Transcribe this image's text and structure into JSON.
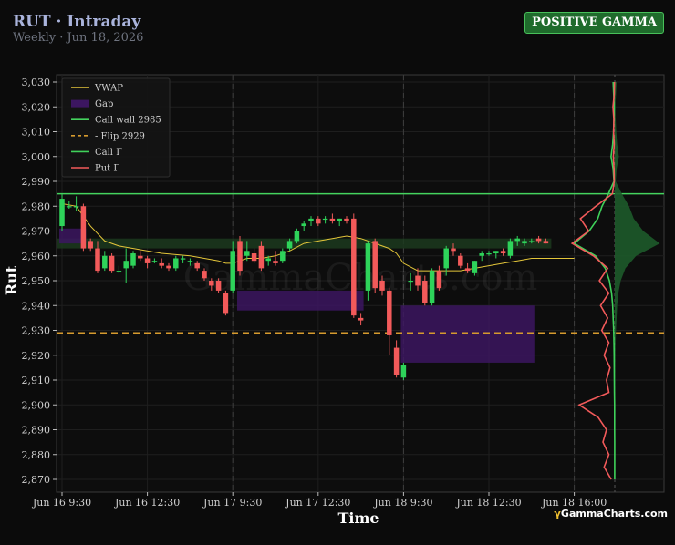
{
  "header": {
    "title": "RUT · Intraday",
    "subtitle": "Weekly · Jun 18, 2026",
    "badge": "POSITIVE GAMMA"
  },
  "watermark": "GammaCharts.com",
  "logo": {
    "glyph": "γ",
    "text": "GammaCharts.com"
  },
  "colors": {
    "background": "#0b0b0b",
    "up": "#2ed35a",
    "down": "#f25a5a",
    "vwap": "#e3c53a",
    "gap": "#3c1660",
    "call_wall": "#44d35e",
    "flip": "#d69a2e",
    "call_gamma": "#3fd15a",
    "put_gamma": "#f25a5a",
    "positive_zone": "#1c3a1f"
  },
  "chart_data": {
    "type": "candlestick",
    "xlabel": "Time",
    "ylabel": "Rut",
    "ylim": [
      2866,
      3032
    ],
    "xlim": [
      0,
      68
    ],
    "y_ticks": [
      2870,
      2880,
      2890,
      2900,
      2910,
      2920,
      2930,
      2940,
      2950,
      2960,
      2970,
      2980,
      2990,
      3000,
      3010,
      3020,
      3030
    ],
    "x_ticks": [
      {
        "x": 0,
        "label": "Jun 16 9:30"
      },
      {
        "x": 12,
        "label": "Jun 16 12:30"
      },
      {
        "x": 24,
        "label": "Jun 17 9:30"
      },
      {
        "x": 36,
        "label": "Jun 17 12:30"
      },
      {
        "x": 48,
        "label": "Jun 18 9:30"
      },
      {
        "x": 60,
        "label": "Jun 18 12:30"
      },
      {
        "x": 72,
        "label": "Jun 18 16:00"
      }
    ],
    "session_breaks": [
      24,
      48,
      72
    ],
    "grid": true,
    "legend_position": "top-left",
    "legend": [
      {
        "kind": "line",
        "label": "VWAP",
        "color": "#e3c53a"
      },
      {
        "kind": "box",
        "label": "Gap",
        "color": "#3c1660"
      },
      {
        "kind": "line",
        "label": "Call wall 2985",
        "color": "#44d35e"
      },
      {
        "kind": "dash",
        "label": "- Flip 2929",
        "color": "#d69a2e"
      },
      {
        "kind": "line",
        "label": "Call Γ",
        "color": "#3fd15a"
      },
      {
        "kind": "line",
        "label": "Put Γ",
        "color": "#f25a5a"
      }
    ],
    "levels": {
      "call_wall": 2985,
      "flip": 2929,
      "positive_zone": [
        2963,
        2967
      ]
    },
    "gaps": [
      {
        "x0": 0,
        "x1": 3,
        "y0": 2965,
        "y1": 2971
      },
      {
        "x0": 25,
        "x1": 42,
        "y0": 2938,
        "y1": 2946
      },
      {
        "x0": 48,
        "x1": 66,
        "y0": 2917,
        "y1": 2940
      }
    ],
    "candles": [
      {
        "x": 0,
        "o": 2972,
        "h": 2985,
        "l": 2970,
        "c": 2983
      },
      {
        "x": 1,
        "o": 2980,
        "h": 2982,
        "l": 2979,
        "c": 2980
      },
      {
        "x": 2,
        "o": 2980,
        "h": 2984,
        "l": 2978,
        "c": 2980
      },
      {
        "x": 3,
        "o": 2980,
        "h": 2981,
        "l": 2962,
        "c": 2963
      },
      {
        "x": 4,
        "o": 2966,
        "h": 2967,
        "l": 2962,
        "c": 2963
      },
      {
        "x": 5,
        "o": 2963,
        "h": 2966,
        "l": 2953,
        "c": 2954
      },
      {
        "x": 6,
        "o": 2955,
        "h": 2962,
        "l": 2954,
        "c": 2960
      },
      {
        "x": 7,
        "o": 2960,
        "h": 2961,
        "l": 2953,
        "c": 2954
      },
      {
        "x": 8,
        "o": 2954,
        "h": 2956,
        "l": 2953,
        "c": 2954
      },
      {
        "x": 9,
        "o": 2955,
        "h": 2963,
        "l": 2949,
        "c": 2958
      },
      {
        "x": 10,
        "o": 2956,
        "h": 2962,
        "l": 2955,
        "c": 2961
      },
      {
        "x": 11,
        "o": 2960,
        "h": 2962,
        "l": 2958,
        "c": 2959
      },
      {
        "x": 12,
        "o": 2959,
        "h": 2960,
        "l": 2955,
        "c": 2957
      },
      {
        "x": 13,
        "o": 2958,
        "h": 2959,
        "l": 2957,
        "c": 2958
      },
      {
        "x": 14,
        "o": 2957,
        "h": 2959,
        "l": 2955,
        "c": 2956
      },
      {
        "x": 15,
        "o": 2956,
        "h": 2957,
        "l": 2954,
        "c": 2955
      },
      {
        "x": 16,
        "o": 2955,
        "h": 2960,
        "l": 2954,
        "c": 2959
      },
      {
        "x": 17,
        "o": 2959,
        "h": 2960,
        "l": 2957,
        "c": 2959
      },
      {
        "x": 18,
        "o": 2958,
        "h": 2959,
        "l": 2956,
        "c": 2958
      },
      {
        "x": 19,
        "o": 2957,
        "h": 2958,
        "l": 2954,
        "c": 2955
      },
      {
        "x": 20,
        "o": 2954,
        "h": 2955,
        "l": 2950,
        "c": 2951
      },
      {
        "x": 21,
        "o": 2950,
        "h": 2951,
        "l": 2946,
        "c": 2948
      },
      {
        "x": 22,
        "o": 2950,
        "h": 2951,
        "l": 2945,
        "c": 2946
      },
      {
        "x": 23,
        "o": 2945,
        "h": 2946,
        "l": 2936,
        "c": 2937
      },
      {
        "x": 24,
        "o": 2946,
        "h": 2966,
        "l": 2945,
        "c": 2962
      },
      {
        "x": 25,
        "o": 2966,
        "h": 2968,
        "l": 2952,
        "c": 2954
      },
      {
        "x": 26,
        "o": 2960,
        "h": 2966,
        "l": 2958,
        "c": 2962
      },
      {
        "x": 27,
        "o": 2961,
        "h": 2963,
        "l": 2957,
        "c": 2958
      },
      {
        "x": 28,
        "o": 2964,
        "h": 2966,
        "l": 2954,
        "c": 2955
      },
      {
        "x": 29,
        "o": 2958,
        "h": 2960,
        "l": 2956,
        "c": 2959
      },
      {
        "x": 30,
        "o": 2958,
        "h": 2962,
        "l": 2956,
        "c": 2957
      },
      {
        "x": 31,
        "o": 2958,
        "h": 2963,
        "l": 2957,
        "c": 2962
      },
      {
        "x": 32,
        "o": 2963,
        "h": 2967,
        "l": 2962,
        "c": 2966
      },
      {
        "x": 33,
        "o": 2966,
        "h": 2971,
        "l": 2965,
        "c": 2970
      },
      {
        "x": 34,
        "o": 2972,
        "h": 2974,
        "l": 2970,
        "c": 2973
      },
      {
        "x": 35,
        "o": 2974,
        "h": 2976,
        "l": 2972,
        "c": 2975
      },
      {
        "x": 36,
        "o": 2975,
        "h": 2976,
        "l": 2972,
        "c": 2973
      },
      {
        "x": 37,
        "o": 2975,
        "h": 2976,
        "l": 2973,
        "c": 2975
      },
      {
        "x": 38,
        "o": 2975,
        "h": 2977,
        "l": 2973,
        "c": 2974
      },
      {
        "x": 39,
        "o": 2974,
        "h": 2975,
        "l": 2972,
        "c": 2975
      },
      {
        "x": 40,
        "o": 2975,
        "h": 2976,
        "l": 2973,
        "c": 2974
      },
      {
        "x": 41,
        "o": 2975,
        "h": 2977,
        "l": 2935,
        "c": 2936
      },
      {
        "x": 42,
        "o": 2935,
        "h": 2937,
        "l": 2932,
        "c": 2934
      },
      {
        "x": 43,
        "o": 2946,
        "h": 2966,
        "l": 2942,
        "c": 2965
      },
      {
        "x": 44,
        "o": 2966,
        "h": 2967,
        "l": 2945,
        "c": 2947
      },
      {
        "x": 45,
        "o": 2950,
        "h": 2952,
        "l": 2944,
        "c": 2946
      },
      {
        "x": 46,
        "o": 2946,
        "h": 2947,
        "l": 2920,
        "c": 2928
      },
      {
        "x": 47,
        "o": 2923,
        "h": 2926,
        "l": 2911,
        "c": 2912
      },
      {
        "x": 48,
        "o": 2911,
        "h": 2917,
        "l": 2910,
        "c": 2916
      },
      {
        "x": 49,
        "o": 2950,
        "h": 2953,
        "l": 2946,
        "c": 2950
      },
      {
        "x": 50,
        "o": 2952,
        "h": 2955,
        "l": 2946,
        "c": 2948
      },
      {
        "x": 51,
        "o": 2950,
        "h": 2952,
        "l": 2940,
        "c": 2941
      },
      {
        "x": 52,
        "o": 2941,
        "h": 2955,
        "l": 2940,
        "c": 2954
      },
      {
        "x": 53,
        "o": 2954,
        "h": 2956,
        "l": 2946,
        "c": 2947
      },
      {
        "x": 54,
        "o": 2955,
        "h": 2964,
        "l": 2952,
        "c": 2963
      },
      {
        "x": 55,
        "o": 2963,
        "h": 2965,
        "l": 2960,
        "c": 2962
      },
      {
        "x": 56,
        "o": 2960,
        "h": 2961,
        "l": 2955,
        "c": 2956
      },
      {
        "x": 57,
        "o": 2955,
        "h": 2957,
        "l": 2953,
        "c": 2954
      },
      {
        "x": 58,
        "o": 2953,
        "h": 2958,
        "l": 2952,
        "c": 2958
      },
      {
        "x": 59,
        "o": 2960,
        "h": 2962,
        "l": 2958,
        "c": 2961
      },
      {
        "x": 60,
        "o": 2961,
        "h": 2962,
        "l": 2960,
        "c": 2961
      },
      {
        "x": 61,
        "o": 2961,
        "h": 2962,
        "l": 2959,
        "c": 2962
      },
      {
        "x": 62,
        "o": 2962,
        "h": 2963,
        "l": 2960,
        "c": 2961
      },
      {
        "x": 63,
        "o": 2960,
        "h": 2967,
        "l": 2959,
        "c": 2966
      },
      {
        "x": 64,
        "o": 2966,
        "h": 2968,
        "l": 2964,
        "c": 2967
      },
      {
        "x": 65,
        "o": 2965,
        "h": 2967,
        "l": 2964,
        "c": 2966
      },
      {
        "x": 66,
        "o": 2966,
        "h": 2967,
        "l": 2965,
        "c": 2966
      },
      {
        "x": 67,
        "o": 2967,
        "h": 2968,
        "l": 2965,
        "c": 2966
      },
      {
        "x": 68,
        "o": 2966,
        "h": 2967,
        "l": 2965,
        "c": 2965
      }
    ],
    "vwap": [
      [
        0,
        2981
      ],
      [
        2,
        2980
      ],
      [
        4,
        2972
      ],
      [
        6,
        2966
      ],
      [
        8,
        2964
      ],
      [
        10,
        2963
      ],
      [
        14,
        2961
      ],
      [
        18,
        2960
      ],
      [
        22,
        2958
      ],
      [
        23,
        2957
      ],
      [
        24,
        2957
      ],
      [
        26,
        2959
      ],
      [
        28,
        2959
      ],
      [
        30,
        2960
      ],
      [
        32,
        2962
      ],
      [
        34,
        2965
      ],
      [
        36,
        2966
      ],
      [
        38,
        2967
      ],
      [
        40,
        2968
      ],
      [
        42,
        2967
      ],
      [
        44,
        2965
      ],
      [
        46,
        2963
      ],
      [
        47,
        2961
      ],
      [
        48,
        2957
      ],
      [
        50,
        2954
      ],
      [
        52,
        2954
      ],
      [
        54,
        2954
      ],
      [
        56,
        2954
      ],
      [
        58,
        2955
      ],
      [
        60,
        2956
      ],
      [
        62,
        2957
      ],
      [
        64,
        2958
      ],
      [
        66,
        2959
      ],
      [
        68,
        2959
      ],
      [
        72,
        2959
      ]
    ],
    "gamma_profile": {
      "strikes": [
        3030,
        3025,
        3020,
        3015,
        3010,
        3005,
        3000,
        2995,
        2990,
        2985,
        2980,
        2975,
        2970,
        2965,
        2960,
        2955,
        2950,
        2945,
        2940,
        2935,
        2930,
        2925,
        2920,
        2915,
        2910,
        2905,
        2900,
        2895,
        2890,
        2885,
        2880,
        2875,
        2870
      ],
      "call_gamma": [
        0.15,
        0.1,
        0.05,
        0.08,
        0.12,
        0.2,
        0.35,
        0.15,
        0.08,
        0.6,
        1.2,
        1.6,
        2.4,
        3.8,
        1.8,
        0.9,
        0.5,
        0.3,
        0.2,
        0.15,
        0.1,
        0.08,
        0.06,
        0.05,
        0.04,
        0.03,
        0.02,
        0.02,
        0.02,
        0.01,
        0.01,
        0.01,
        0.01
      ],
      "put_gamma": [
        0.02,
        0.05,
        0.15,
        0.08,
        0.1,
        0.05,
        0.12,
        0.06,
        0.05,
        0.2,
        1.6,
        2.9,
        2.2,
        3.6,
        1.8,
        0.6,
        1.3,
        0.5,
        1.2,
        0.6,
        1.1,
        0.5,
        0.9,
        0.4,
        0.7,
        0.5,
        3.0,
        1.4,
        0.7,
        1.0,
        0.5,
        0.9,
        0.3
      ]
    }
  }
}
